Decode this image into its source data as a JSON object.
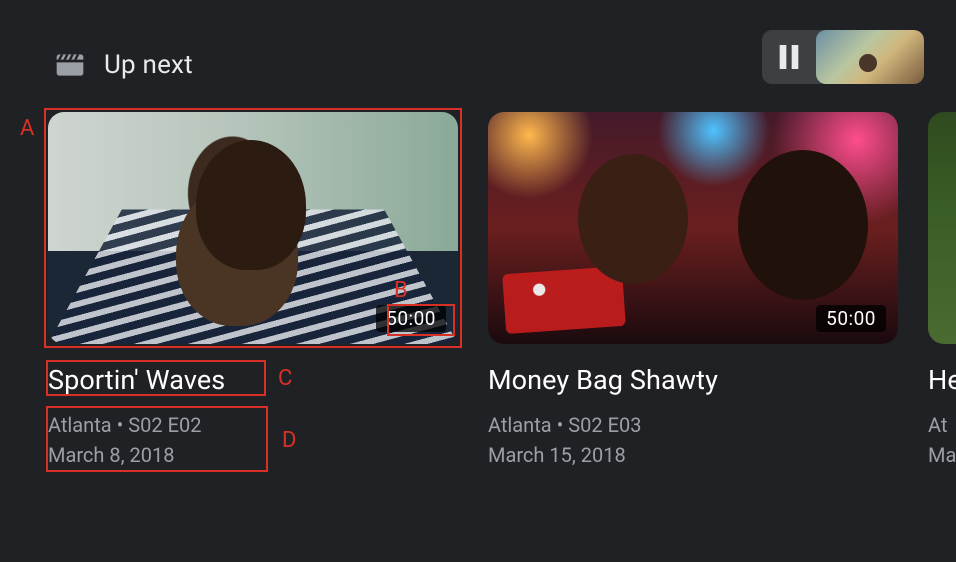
{
  "header": {
    "title": "Up next",
    "icon": "clapperboard-icon"
  },
  "playback_status": {
    "state": "paused",
    "icon": "pause-icon"
  },
  "annotations": {
    "A": "A",
    "B": "B",
    "C": "C",
    "D": "D"
  },
  "cards": [
    {
      "title": "Sportin' Waves",
      "duration": "50:00",
      "show": "Atlanta",
      "episode_code": "S02 E02",
      "air_date": "March 8, 2018",
      "meta_line1": "Atlanta • S02 E02",
      "meta_line2": "March 8, 2018",
      "focused": true
    },
    {
      "title": "Money Bag Shawty",
      "duration": "50:00",
      "show": "Atlanta",
      "episode_code": "S02 E03",
      "air_date": "March 15, 2018",
      "meta_line1": "Atlanta • S02 E03",
      "meta_line2": "March 15, 2018",
      "focused": false
    },
    {
      "title": "He",
      "duration": "",
      "show": "Atlanta",
      "episode_code": "",
      "air_date": "",
      "meta_line1": "At",
      "meta_line2": "Ma",
      "focused": false
    }
  ]
}
